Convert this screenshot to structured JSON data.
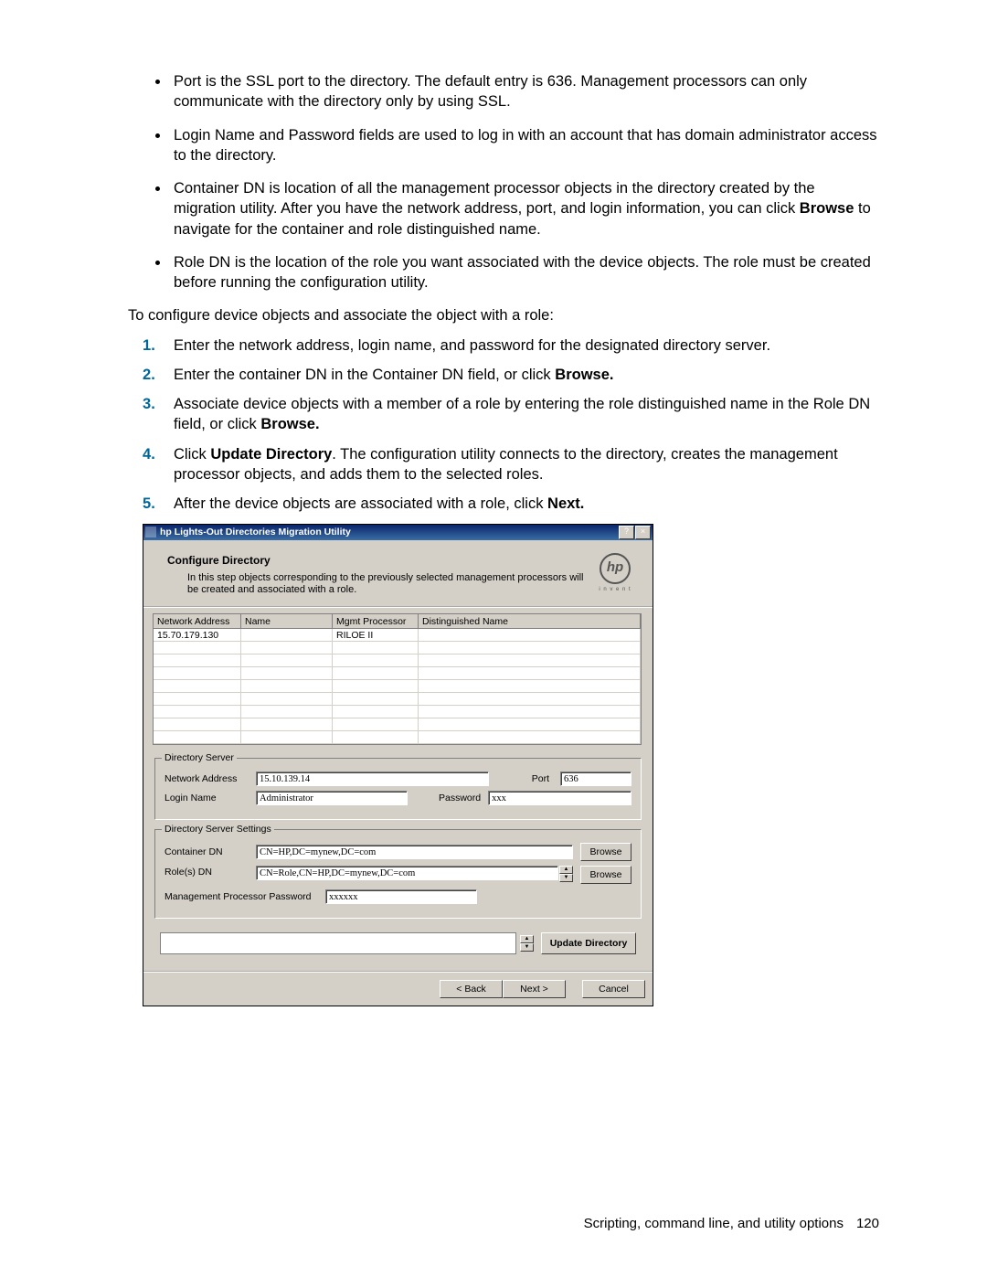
{
  "bullets": [
    {
      "text": "Port is the SSL port to the directory. The default entry is 636. Management processors can only communicate with the directory only by using SSL."
    },
    {
      "text": "Login Name and Password fields are used to log in with an account that has domain administrator access to the directory."
    },
    {
      "text_before": "Container DN is location of all the management processor objects in the directory created by the migration utility. After you have the network address, port, and login information, you can click ",
      "bold": "Browse",
      "text_after": " to navigate for the container and role distinguished name."
    },
    {
      "text": "Role DN is the location of the role you want associated with the device objects. The role must be created before running the configuration utility."
    }
  ],
  "intro": "To configure device objects and associate the object with a role:",
  "steps": [
    {
      "text": "Enter the network address, login name, and password for the designated directory server."
    },
    {
      "text_before": "Enter the container DN in the Container DN field, or click ",
      "bold": "Browse.",
      "text_after": ""
    },
    {
      "text_before": "Associate device objects with a member of a role by entering the role distinguished name in the Role DN field, or click ",
      "bold": "Browse.",
      "text_after": ""
    },
    {
      "text_before": "Click ",
      "bold": "Update Directory",
      "text_after": ". The configuration utility connects to the directory, creates the management processor objects, and adds them to the selected roles."
    },
    {
      "text_before": "After the device objects are associated with a role, click ",
      "bold": "Next.",
      "text_after": ""
    }
  ],
  "window": {
    "title": "hp Lights-Out Directories Migration Utility",
    "help": "?",
    "close": "×",
    "header_title": "Configure Directory",
    "header_desc": "In this step objects corresponding to the previously selected management processors will be created and associated with a role.",
    "logo": "hp",
    "logo_tag": "i n v e n t",
    "grid": {
      "cols": [
        "Network Address",
        "Name",
        "Mgmt Processor",
        "Distinguished Name"
      ],
      "row": [
        "15.70.179.130",
        "",
        "RILOE II",
        ""
      ]
    },
    "ds": {
      "legend": "Directory Server",
      "addr_label": "Network Address",
      "addr": "15.10.139.14",
      "port_label": "Port",
      "port": "636",
      "login_label": "Login Name",
      "login": "Administrator",
      "pass_label": "Password",
      "pass": "xxx"
    },
    "dss": {
      "legend": "Directory Server Settings",
      "cdn_label": "Container DN",
      "cdn": "CN=HP,DC=mynew,DC=com",
      "rdn_label": "Role(s) DN",
      "rdn": "CN=Role,CN=HP,DC=mynew,DC=com",
      "browse": "Browse",
      "mpp_label": "Management Processor Password",
      "mpp": "xxxxxx"
    },
    "update": "Update Directory",
    "nav": {
      "back": "< Back",
      "next": "Next >",
      "cancel": "Cancel"
    }
  },
  "footer": {
    "text": "Scripting, command line, and utility options",
    "page": "120"
  }
}
